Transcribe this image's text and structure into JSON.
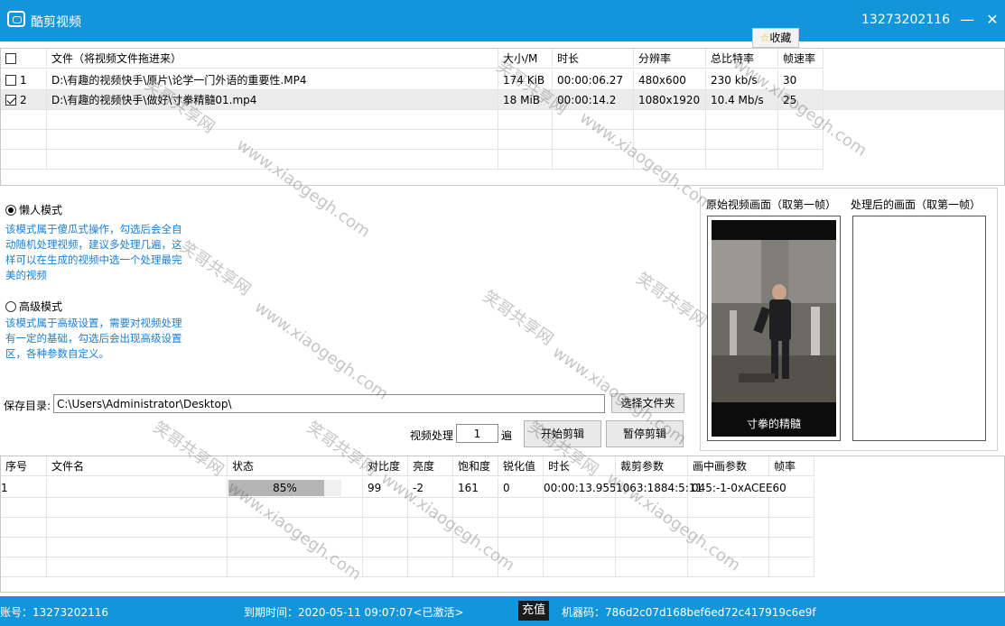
{
  "app": {
    "title": "酷剪视频",
    "account": "13273202116",
    "minimize_glyph": "—",
    "close_glyph": "✕",
    "favorite_label": "收藏"
  },
  "file_table": {
    "headers": [
      "文件（将视频文件拖进来）",
      "大小/M",
      "时长",
      "分辨率",
      "总比特率",
      "帧速率"
    ],
    "rows": [
      {
        "index": "1",
        "checked": false,
        "file": "D:\\有趣的视频快手\\原片\\论学一门外语的重要性.MP4",
        "size": "174 KiB",
        "duration": "00:00:06.27",
        "resolution": "480x600",
        "bitrate": "230 kb/s",
        "fps": "30"
      },
      {
        "index": "2",
        "checked": true,
        "file": "D:\\有趣的视频快手\\做好\\寸拳精髓01.mp4",
        "size": "18 MiB",
        "duration": "00:00:14.2",
        "resolution": "1080x1920",
        "bitrate": "10.4 Mb/s",
        "fps": "25"
      }
    ]
  },
  "modes": {
    "lazy": {
      "label": "懒人模式",
      "selected": true,
      "desc": "该模式属于傻瓜式操作，勾选后会全自动随机处理视频，建议多处理几遍，这样可以在生成的视频中选一个处理最完美的视频"
    },
    "advanced": {
      "label": "高级模式",
      "selected": false,
      "desc": "该模式属于高级设置，需要对视频处理有一定的基础，勾选后会出现高级设置区，各种参数自定义。"
    }
  },
  "preview": {
    "original_label": "原始视频画面（取第一帧）",
    "processed_label": "处理后的画面（取第一帧）",
    "caption": "寸拳的精髓"
  },
  "save": {
    "label": "保存目录:",
    "path": "C:\\Users\\Administrator\\Desktop\\",
    "choose_button": "选择文件夹"
  },
  "process": {
    "label": "视频处理",
    "count": "1",
    "unit": "遍",
    "start_button": "开始剪辑",
    "pause_button": "暂停剪辑"
  },
  "job_table": {
    "headers": [
      "序号",
      "文件名",
      "状态",
      "对比度",
      "亮度",
      "饱和度",
      "锐化值",
      "时长",
      "裁剪参数",
      "画中画参数",
      "帧率"
    ],
    "rows": [
      {
        "index": "1",
        "name": "",
        "progress": 85,
        "progress_text": "85%",
        "contrast": "99",
        "brightness": "-2",
        "saturation": "161",
        "sharpen": "0",
        "duration": "00:00:13.955",
        "crop": "1063:1884:5:11",
        "pip": "045:-1-0xACEE60",
        "fps": ""
      }
    ]
  },
  "status": {
    "account": "账号：13273202116",
    "expiry": "到期时间：2020-05-11 09:07:07<已激活>",
    "recharge": "充值",
    "machine": "机器码：786d2c07d168bef6ed72c417919c6e9f"
  },
  "watermark": {
    "cn": "笑哥共享网",
    "url": "www.xiaogegh.com"
  },
  "colors": {
    "accent": "#1296db",
    "link_text": "#1a7fd4"
  }
}
